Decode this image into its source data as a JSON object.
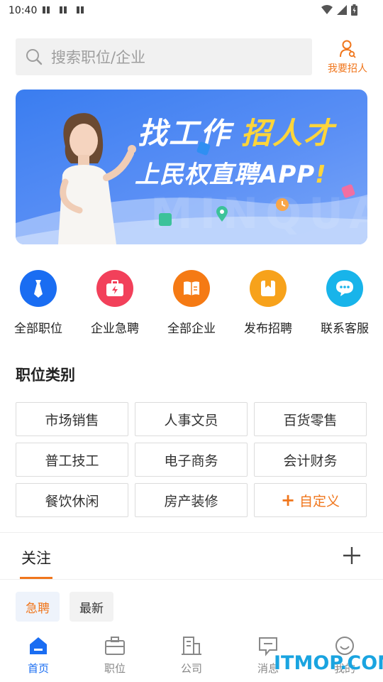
{
  "status_bar": {
    "time": "10:40"
  },
  "search": {
    "placeholder": "搜索职位/企业"
  },
  "recruit_button": {
    "label": "我要招人",
    "color": "#f0761c"
  },
  "banner": {
    "line1_a": "找工作",
    "line1_b": "招人才",
    "line2": "上民权直聘APP",
    "line2_mark": "!",
    "watermark_text": "MINQUAN"
  },
  "quick_menu": [
    {
      "label": "全部职位",
      "icon": "tie-icon",
      "color": "#1a6df2"
    },
    {
      "label": "企业急聘",
      "icon": "urgent-bag-icon",
      "color": "#f2405a"
    },
    {
      "label": "全部企业",
      "icon": "book-icon",
      "color": "#f57a14"
    },
    {
      "label": "发布招聘",
      "icon": "bookmark-icon",
      "color": "#f7a21b"
    },
    {
      "label": "联系客服",
      "icon": "chat-icon",
      "color": "#18b4ea"
    }
  ],
  "categories": {
    "title": "职位类别",
    "items": [
      "市场销售",
      "人事文员",
      "百货零售",
      "普工技工",
      "电子商务",
      "会计财务",
      "餐饮休闲",
      "房产装修"
    ],
    "custom_label": "自定义",
    "custom_plus": "+"
  },
  "follow": {
    "tab_label": "关注",
    "add_icon": "plus-icon"
  },
  "filters": {
    "urgent": "急聘",
    "latest": "最新"
  },
  "bottom_nav": [
    {
      "label": "首页",
      "icon": "home-icon",
      "active": true
    },
    {
      "label": "职位",
      "icon": "briefcase-icon",
      "active": false
    },
    {
      "label": "公司",
      "icon": "building-icon",
      "active": false
    },
    {
      "label": "消息",
      "icon": "message-icon",
      "active": false
    },
    {
      "label": "我的",
      "icon": "smile-icon",
      "active": false
    }
  ],
  "watermark": "ITMOP.COM",
  "colors": {
    "accent": "#f0761c",
    "primary": "#1a6df2"
  }
}
